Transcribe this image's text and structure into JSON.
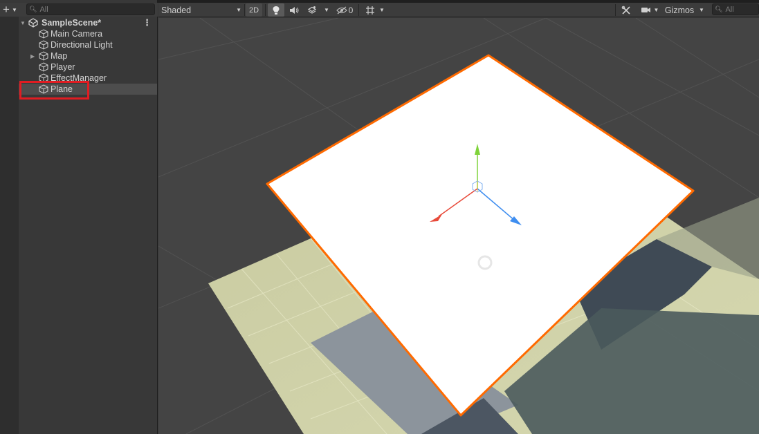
{
  "hierarchy": {
    "search_placeholder": "All",
    "scene_name": "SampleScene*",
    "items": [
      {
        "label": "Main Camera",
        "has_children": false,
        "selected": false
      },
      {
        "label": "Directional Light",
        "has_children": false,
        "selected": false
      },
      {
        "label": "Map",
        "has_children": true,
        "selected": false
      },
      {
        "label": "Player",
        "has_children": false,
        "selected": false
      },
      {
        "label": "EffectManager",
        "has_children": false,
        "selected": false
      },
      {
        "label": "Plane",
        "has_children": false,
        "selected": true
      }
    ]
  },
  "scene_toolbar": {
    "shading_mode": "Shaded",
    "mode_2d": "2D",
    "hidden_count": "0",
    "gizmos_label": "Gizmos",
    "search_placeholder": "All"
  },
  "icons": {
    "add": "plus-icon",
    "scene": "unity-scene-icon",
    "gameobject": "cube-icon",
    "light": "lightbulb-icon",
    "audio": "speaker-icon",
    "effects": "effects-icon",
    "visibility": "eye-slash-icon",
    "grid": "grid-icon",
    "tools": "tools-icon",
    "camera": "camera-icon",
    "search": "search-icon"
  },
  "colors": {
    "selection_outline": "#ff6a00",
    "highlight_box": "#e01c22",
    "axis_x": "#e84a3a",
    "axis_y": "#7fd33a",
    "axis_z": "#3f8ef0"
  }
}
